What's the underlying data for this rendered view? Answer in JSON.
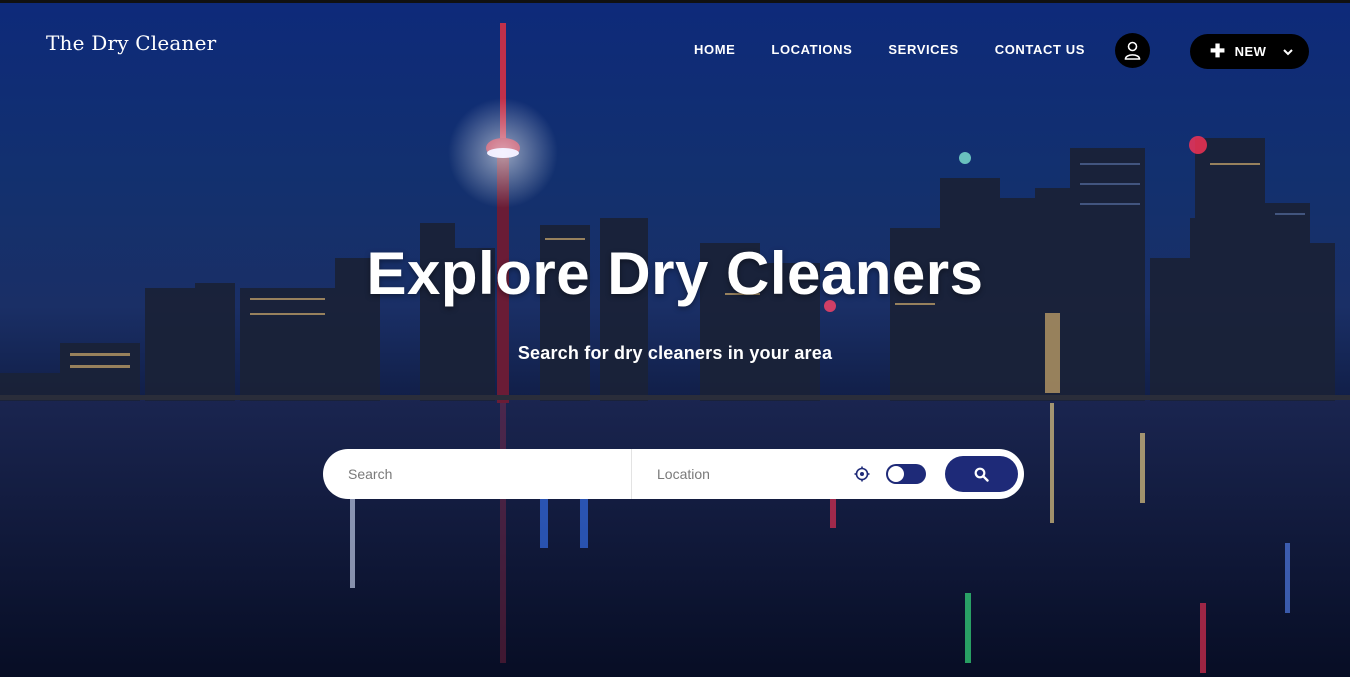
{
  "brand": {
    "logo_text": "The Dry Cleaner"
  },
  "nav": {
    "items": [
      {
        "label": "HOME"
      },
      {
        "label": "LOCATIONS"
      },
      {
        "label": "SERVICES"
      },
      {
        "label": "CONTACT US"
      }
    ],
    "user_icon": "user-icon",
    "new_button": {
      "label": "NEW",
      "icon": "plus-icon",
      "caret": "chevron-down-icon"
    }
  },
  "hero": {
    "headline": "Explore Dry Cleaners",
    "subheadline": "Search for dry cleaners in your area",
    "background": "city-skyline-night-image"
  },
  "search": {
    "search_placeholder": "Search",
    "location_placeholder": "Location",
    "locate_icon": "crosshair-icon",
    "toggle_on": true,
    "submit_icon": "search-icon"
  },
  "colors": {
    "accent": "#1e2a78",
    "button_dark": "#000000",
    "text_light": "#ffffff"
  }
}
